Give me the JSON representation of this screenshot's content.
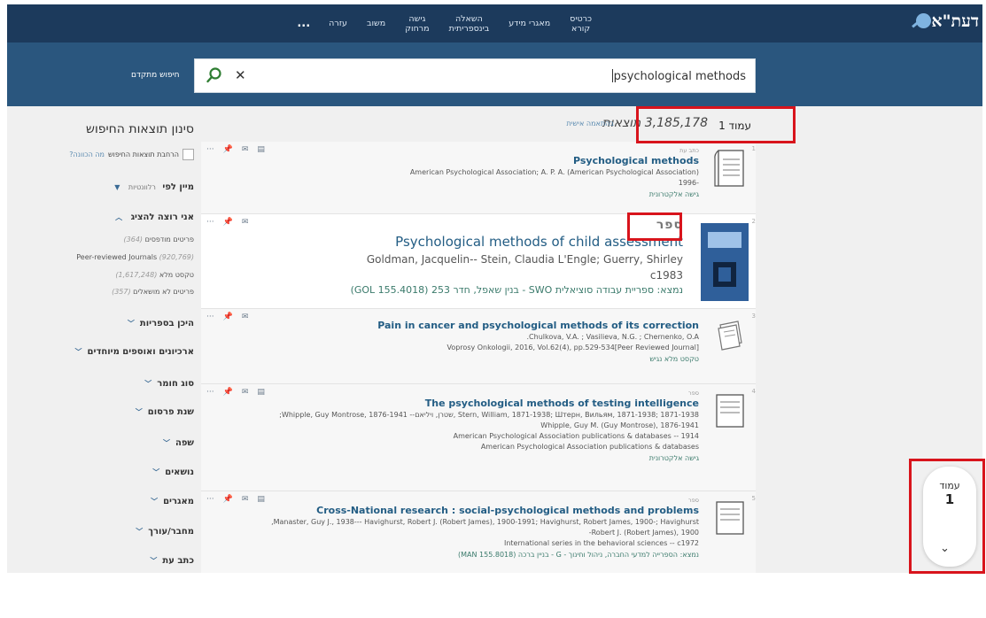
{
  "brand": {
    "logo": "דעת\"א"
  },
  "nav": {
    "items": [
      {
        "label": "כרטיס\nקורא"
      },
      {
        "label": "מאגרי מידע"
      },
      {
        "label": "השאלה\nבינספריתית"
      },
      {
        "label": "גישה\nמרחוק"
      },
      {
        "label": "משוב"
      },
      {
        "label": "עזרה"
      }
    ],
    "more": "..."
  },
  "search": {
    "query": "psychological methods",
    "advanced_label": "חיפוש מתקדם"
  },
  "results": {
    "page_label": "עמוד 1",
    "count_text": "3,185,178 תוצאות",
    "personalize_link": "בהתאמה אישית",
    "items": [
      {
        "num": "1",
        "type": "כתב עת",
        "title": "Psychological methods",
        "meta1": "American Psychological Association; A. P. A. (American Psychological Association)",
        "meta2": "-1996",
        "link": "גישה אלקטרונית"
      },
      {
        "num": "2",
        "type": "ספר",
        "title": "Psychological methods of child assessment",
        "meta1": "Goldman, Jacquelin-- Stein, Claudia L'Engle; Guerry, Shirley",
        "meta2": "c1983",
        "link": "נמצא: ספריית עבודה סוציאלית SWO - בנין שאפל, חדר 253 (GOL 155.4018)"
      },
      {
        "num": "3",
        "type": "",
        "title": "Pain in cancer and psychological methods of its correction",
        "meta1": "Chulkova, V.A. ; Vasilieva, N.G. ; Chernenko, O.A.",
        "meta2": "Voprosy Onkologii, 2016, Vol.62(4), pp.529-534[Peer Reviewed Journal]",
        "link": "טקסט מלא נגיש"
      },
      {
        "num": "4",
        "type": "ספר",
        "title": "The psychological methods of testing intelligence",
        "meta1": "Stern, William, 1871-1938; Штерн, Вильям, 1871-1938; 1871-1938 ,שטרן, ויליאם-- Whipple, Guy Montrose, 1876-1941;",
        "meta2": "Whipple, Guy M. (Guy Montrose), 1876-1941",
        "meta3": "American Psychological Association publications & databases -- 1914",
        "meta4": "American Psychological Association publications & databases",
        "link": "גישה אלקטרונית"
      },
      {
        "num": "5",
        "type": "ספר",
        "title": "Cross-National research : social-psychological methods and problems",
        "meta1": "Manaster, Guy J., 1938--- Havighurst, Robert J. (Robert James), 1900-1991; Havighurst, Robert James, 1900-; Havighurst,",
        "meta2": "Robert J. (Robert James), 1900-",
        "meta3": "International series in the behavioral sciences -- c1972",
        "link": "נמצא: הספרייה למדעי החברה, ניהול וחינוך - G - בניין ברכה (MAN 155.8018)"
      }
    ]
  },
  "filters": {
    "title": "סינון תוצאות החיפוש",
    "expand_label": "הרחבת תוצאות החיפוש",
    "expand_what": "מה הכוונה?",
    "sort_label": "מיין לפי",
    "sort_value": "רלוונטיות",
    "show_label": "אני רוצה להציג",
    "show_options": [
      {
        "label": "פריטים מודפסים",
        "count": "(364)"
      },
      {
        "label": "Peer-reviewed Journals",
        "count": "(920,769)"
      },
      {
        "label": "טקסט מלא",
        "count": "(1,617,248)"
      },
      {
        "label": "פריטים לא מושאלים",
        "count": "(357)"
      }
    ],
    "sections": [
      {
        "label": "היכן בספריות"
      },
      {
        "label": "ארכיונים ואוספים מיוחדים"
      },
      {
        "label": "סוג חומר"
      },
      {
        "label": "שנת פרסום"
      },
      {
        "label": "שפה"
      },
      {
        "label": "נושאים"
      },
      {
        "label": "מאגרים"
      },
      {
        "label": "מחבר/עורך"
      },
      {
        "label": "כתב עת"
      }
    ]
  },
  "pager": {
    "label": "עמוד",
    "page": "1"
  }
}
